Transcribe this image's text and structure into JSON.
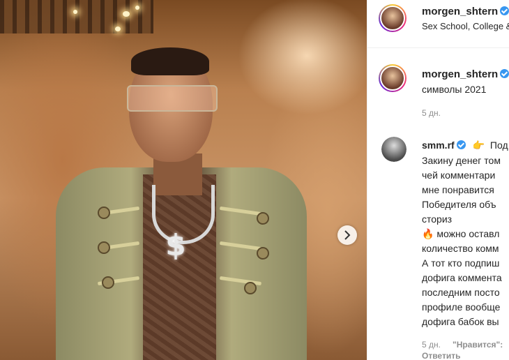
{
  "header": {
    "username": "morgen_shtern",
    "location": "Sex School, College &"
  },
  "caption": {
    "username": "morgen_shtern",
    "text": "символы 2021",
    "time": "5 дн."
  },
  "comment": {
    "username": "smm.rf",
    "first_line": "Под",
    "lines": [
      "Закину денег том",
      "чей комментари",
      "мне понравится",
      "Победителя объ",
      "сториз",
      "можно оставл",
      "количество комм",
      "А тот кто подпиш",
      "дофига коммента",
      "последним посто",
      "профиле вообще",
      "дофига бабок вы"
    ],
    "time": "5 дн.",
    "likes_label": "\"Нравится\":",
    "reply_label": "Ответить"
  },
  "icons": {
    "verified": "verified-badge-icon",
    "point": "pointing-hand-icon",
    "fire": "fire-icon",
    "next": "chevron-right-icon"
  },
  "colors": {
    "verified": "#3897f0",
    "muted": "#8e8e8e"
  }
}
